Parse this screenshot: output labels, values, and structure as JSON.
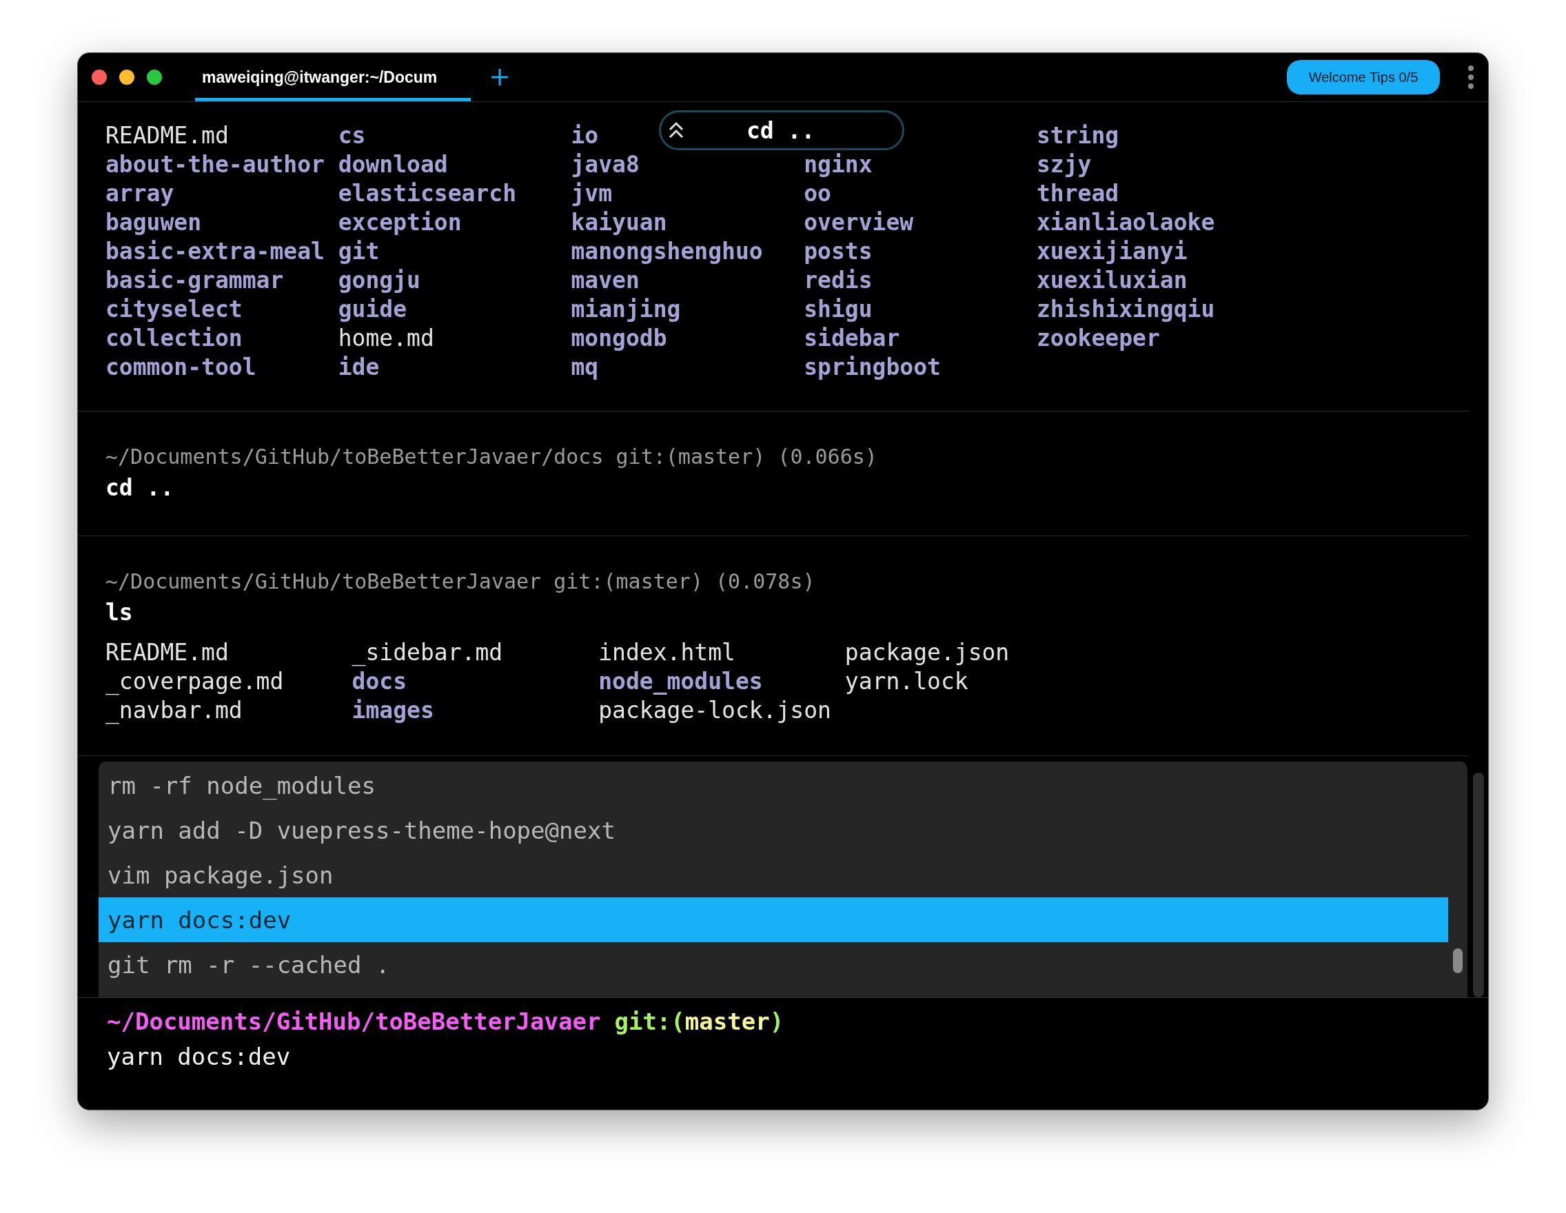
{
  "window": {
    "tabs": [
      {
        "label": "maweiqing@itwanger:~/Docum",
        "selected": true
      }
    ],
    "welcome_button": "Welcome Tips 0/5"
  },
  "sticky_header": {
    "command": "cd .."
  },
  "blocks": [
    {
      "kind": "output",
      "columns": [
        [
          {
            "name": "README.md",
            "kind": "file"
          },
          {
            "name": "about-the-author",
            "kind": "dir"
          },
          {
            "name": "array",
            "kind": "dir"
          },
          {
            "name": "baguwen",
            "kind": "dir"
          },
          {
            "name": "basic-extra-meal",
            "kind": "dir"
          },
          {
            "name": "basic-grammar",
            "kind": "dir"
          },
          {
            "name": "cityselect",
            "kind": "dir"
          },
          {
            "name": "collection",
            "kind": "dir"
          },
          {
            "name": "common-tool",
            "kind": "dir"
          }
        ],
        [
          {
            "name": "cs",
            "kind": "dir"
          },
          {
            "name": "download",
            "kind": "dir"
          },
          {
            "name": "elasticsearch",
            "kind": "dir"
          },
          {
            "name": "exception",
            "kind": "dir"
          },
          {
            "name": "git",
            "kind": "dir"
          },
          {
            "name": "gongju",
            "kind": "dir"
          },
          {
            "name": "guide",
            "kind": "dir"
          },
          {
            "name": "home.md",
            "kind": "file"
          },
          {
            "name": "ide",
            "kind": "dir"
          }
        ],
        [
          {
            "name": "io",
            "kind": "dir"
          },
          {
            "name": "java8",
            "kind": "dir"
          },
          {
            "name": "jvm",
            "kind": "dir"
          },
          {
            "name": "kaiyuan",
            "kind": "dir"
          },
          {
            "name": "manongshenghuo",
            "kind": "dir"
          },
          {
            "name": "maven",
            "kind": "dir"
          },
          {
            "name": "mianjing",
            "kind": "dir"
          },
          {
            "name": "mongodb",
            "kind": "dir"
          },
          {
            "name": "mq",
            "kind": "dir"
          }
        ],
        {
          "starts_below_header": true,
          "entries": [
            {
              "name": "nginx",
              "kind": "dir"
            },
            {
              "name": "oo",
              "kind": "dir"
            },
            {
              "name": "overview",
              "kind": "dir"
            },
            {
              "name": "posts",
              "kind": "dir"
            },
            {
              "name": "redis",
              "kind": "dir"
            },
            {
              "name": "shigu",
              "kind": "dir"
            },
            {
              "name": "sidebar",
              "kind": "dir"
            },
            {
              "name": "springboot",
              "kind": "dir"
            }
          ]
        },
        [
          {
            "name": "string",
            "kind": "dir"
          },
          {
            "name": "szjy",
            "kind": "dir"
          },
          {
            "name": "thread",
            "kind": "dir"
          },
          {
            "name": "xianliaolaoke",
            "kind": "dir"
          },
          {
            "name": "xuexijianyi",
            "kind": "dir"
          },
          {
            "name": "xuexiluxian",
            "kind": "dir"
          },
          {
            "name": "zhishixingqiu",
            "kind": "dir"
          },
          {
            "name": "zookeeper",
            "kind": "dir"
          }
        ]
      ]
    },
    {
      "kind": "command",
      "prompt": "~/Documents/GitHub/toBeBetterJavaer/docs git:(master) (0.066s)",
      "command": "cd .."
    },
    {
      "kind": "command",
      "prompt": "~/Documents/GitHub/toBeBetterJavaer git:(master) (0.078s)",
      "command": "ls",
      "columns": [
        [
          {
            "name": "README.md",
            "kind": "file"
          },
          {
            "name": "_coverpage.md",
            "kind": "file"
          },
          {
            "name": "_navbar.md",
            "kind": "file"
          }
        ],
        [
          {
            "name": "_sidebar.md",
            "kind": "file"
          },
          {
            "name": "docs",
            "kind": "dir"
          },
          {
            "name": "images",
            "kind": "dir"
          }
        ],
        [
          {
            "name": "index.html",
            "kind": "file"
          },
          {
            "name": "node_modules",
            "kind": "dir"
          },
          {
            "name": "package-lock.json",
            "kind": "file"
          }
        ],
        [
          {
            "name": "package.json",
            "kind": "file"
          },
          {
            "name": "yarn.lock",
            "kind": "file"
          }
        ]
      ]
    }
  ],
  "history_menu": [
    {
      "text": "rm -rf node_modules",
      "selected": false
    },
    {
      "text": "yarn add -D vuepress-theme-hope@next",
      "selected": false
    },
    {
      "text": "vim package.json",
      "selected": false
    },
    {
      "text": "yarn docs:dev",
      "selected": true
    },
    {
      "text": "git rm -r --cached .",
      "selected": false
    }
  ],
  "input": {
    "path": "~/Documents/GitHub/toBeBetterJavaer",
    "git_open": "git:(",
    "branch": "master",
    "git_close": ")",
    "value": "yarn docs:dev"
  }
}
